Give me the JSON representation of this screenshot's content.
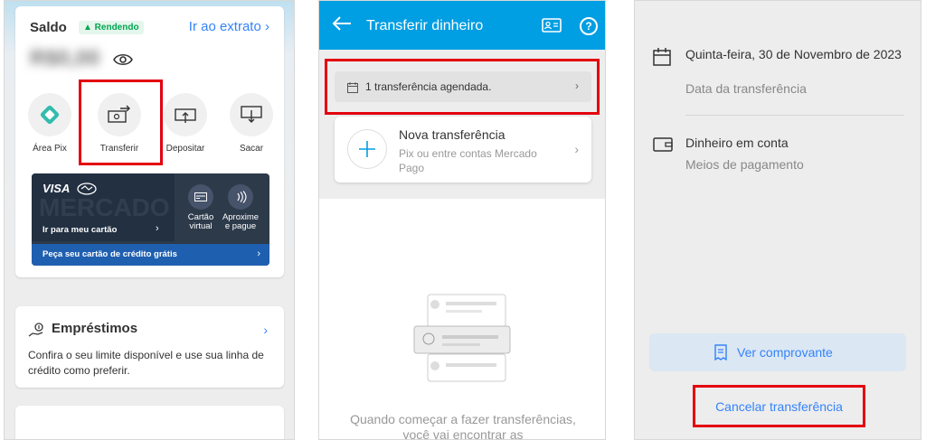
{
  "panel1": {
    "saldo": "Saldo",
    "rendendo_badge": "▲ Rendendo",
    "extrato_link": "Ir ao extrato",
    "balance_hidden": "R$0,00",
    "actions": [
      {
        "label": "Área Pix"
      },
      {
        "label": "Transferir"
      },
      {
        "label": "Depositar"
      },
      {
        "label": "Sacar"
      }
    ],
    "card": {
      "brand": "VISA",
      "watermark": "MERCADO",
      "ir_cartao": "Ir para meu cartão",
      "cartao_virtual": "Cartão virtual",
      "aproxime": "Aproxime e pague",
      "peca_cartao": "Peça seu cartão de crédito grátis"
    },
    "loans": {
      "title": "Empréstimos",
      "description": "Confira o seu limite disponível e use sua linha de crédito como preferir."
    }
  },
  "panel2": {
    "title": "Transferir dinheiro",
    "scheduled": "1 transferência agendada.",
    "nova_title": "Nova transferência",
    "nova_sub": "Pix ou entre contas Mercado Pago",
    "empty_text": "Quando começar a fazer transferências, você vai encontrar as"
  },
  "panel3": {
    "date_value": "Quinta-feira, 30 de Novembro de 2023",
    "date_label": "Data da transferência",
    "payment_value": "Dinheiro em conta",
    "payment_label": "Meios de pagamento",
    "ver_comprovante": "Ver comprovante",
    "cancelar": "Cancelar transferência"
  },
  "colors": {
    "mp_blue": "#009ee3",
    "link_blue": "#3483fa",
    "highlight_red": "#e3000f",
    "pix_teal": "#32bcad",
    "rendendo_green": "#00a650"
  }
}
